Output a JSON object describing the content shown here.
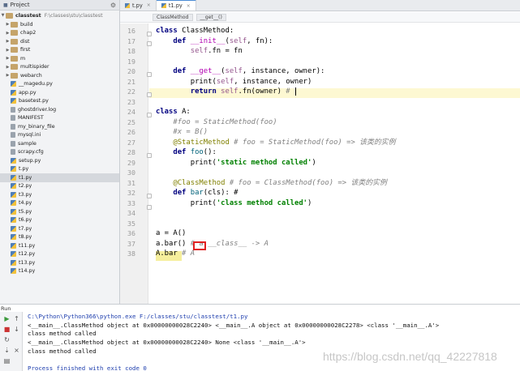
{
  "sidebar": {
    "header": "Project",
    "root": {
      "name": "classtest",
      "path": "F:\\classes\\stu\\classtest"
    },
    "items": [
      {
        "label": "build",
        "type": "folder"
      },
      {
        "label": "chap2",
        "type": "folder"
      },
      {
        "label": "dist",
        "type": "folder"
      },
      {
        "label": "first",
        "type": "folder"
      },
      {
        "label": "m",
        "type": "folder"
      },
      {
        "label": "multispider",
        "type": "folder"
      },
      {
        "label": "webarch",
        "type": "folder"
      },
      {
        "label": "__magedu.py",
        "type": "py"
      },
      {
        "label": "app.py",
        "type": "py"
      },
      {
        "label": "basetest.py",
        "type": "py"
      },
      {
        "label": "ghostdriver.log",
        "type": "txt"
      },
      {
        "label": "MANIFEST",
        "type": "txt"
      },
      {
        "label": "my_binary_file",
        "type": "txt"
      },
      {
        "label": "mysql.ini",
        "type": "txt"
      },
      {
        "label": "sample",
        "type": "txt"
      },
      {
        "label": "scrapy.cfg",
        "type": "txt"
      },
      {
        "label": "setup.py",
        "type": "py"
      },
      {
        "label": "t.py",
        "type": "py"
      },
      {
        "label": "t1.py",
        "type": "py",
        "selected": true
      },
      {
        "label": "t2.py",
        "type": "py"
      },
      {
        "label": "t3.py",
        "type": "py"
      },
      {
        "label": "t4.py",
        "type": "py"
      },
      {
        "label": "t5.py",
        "type": "py"
      },
      {
        "label": "t6.py",
        "type": "py"
      },
      {
        "label": "t7.py",
        "type": "py"
      },
      {
        "label": "t8.py",
        "type": "py"
      },
      {
        "label": "t11.py",
        "type": "py"
      },
      {
        "label": "t12.py",
        "type": "py"
      },
      {
        "label": "t13.py",
        "type": "py"
      },
      {
        "label": "t14.py",
        "type": "py"
      }
    ]
  },
  "editor": {
    "tabs": [
      {
        "label": "t.py",
        "active": false
      },
      {
        "label": "t1.py",
        "active": true
      }
    ],
    "breadcrumbs": [
      "ClassMethod",
      "__get__()"
    ],
    "line_numbers": [
      "16",
      "17",
      "18",
      "19",
      "20",
      "21",
      "22",
      "23",
      "24",
      "25",
      "26",
      "27",
      "28",
      "29",
      "30",
      "31",
      "32",
      "33",
      "34",
      "35",
      "36",
      "37",
      "38"
    ],
    "lines": {
      "l16": [
        "class",
        "ClassMethod:"
      ],
      "l17": [
        "def",
        "__init__",
        "(",
        "self",
        ", fn):"
      ],
      "l18": [
        "self",
        ".fn = fn"
      ],
      "l20": [
        "def",
        "__get__",
        "(",
        "self",
        ", instance, owner):"
      ],
      "l21": [
        "print(",
        "self",
        ", instance, owner)"
      ],
      "l22": [
        "return",
        "self",
        ".fn(owner)",
        " #"
      ],
      "l24": [
        "class",
        "A:"
      ],
      "l25": "#foo = StaticMethod(foo)",
      "l26": "#x = B()",
      "l27": [
        "@StaticMethod",
        " # foo = StaticMethod(foo) => 该类的实例"
      ],
      "l28": [
        "def",
        "foo",
        "():"
      ],
      "l29": [
        "print(",
        "'static method called'",
        ")"
      ],
      "l31": [
        "@ClassMethod",
        " # foo = ClassMethod(foo) => 该类的实例"
      ],
      "l32": [
        "def",
        "bar",
        "(cls): #"
      ],
      "l33": [
        "print(",
        "'class method called'",
        ")"
      ],
      "l36": "a = A()",
      "l37": [
        "a.bar()",
        " # ",
        "a.__class__ -> A"
      ],
      "l38": [
        "A.bar",
        " # A"
      ]
    }
  },
  "run": {
    "label": "Run",
    "output": [
      {
        "text": "C:\\Python\\Python366\\python.exe F:/classes/stu/classtest/t1.py",
        "kind": "cmd"
      },
      {
        "text": "<__main__.ClassMethod object at 0x00000000028C2240> <__main__.A object at 0x00000000028C2278> <class '__main__.A'>",
        "kind": "out"
      },
      {
        "text": "class method called",
        "kind": "out"
      },
      {
        "text": "<__main__.ClassMethod object at 0x00000000028C2240> None <class '__main__.A'>",
        "kind": "out"
      },
      {
        "text": "class method called",
        "kind": "out"
      },
      {
        "text": "",
        "kind": "out"
      },
      {
        "text": "Process finished with exit code 0",
        "kind": "fin"
      }
    ],
    "tools": [
      "run-icon",
      "stop-icon",
      "rerun-icon",
      "scroll-icon",
      "pin-icon",
      "print-icon",
      "settings-icon",
      "close-icon"
    ]
  },
  "watermark": "https://blog.csdn.net/qq_42227818",
  "colors": {
    "keyword": "#000080",
    "string": "#008000",
    "comment": "#808080",
    "self": "#94558d",
    "decorator": "#808000",
    "highlight_line": "#fdf8d2",
    "error_box": "#e02020",
    "tab_accent": "#4a8bd4"
  }
}
